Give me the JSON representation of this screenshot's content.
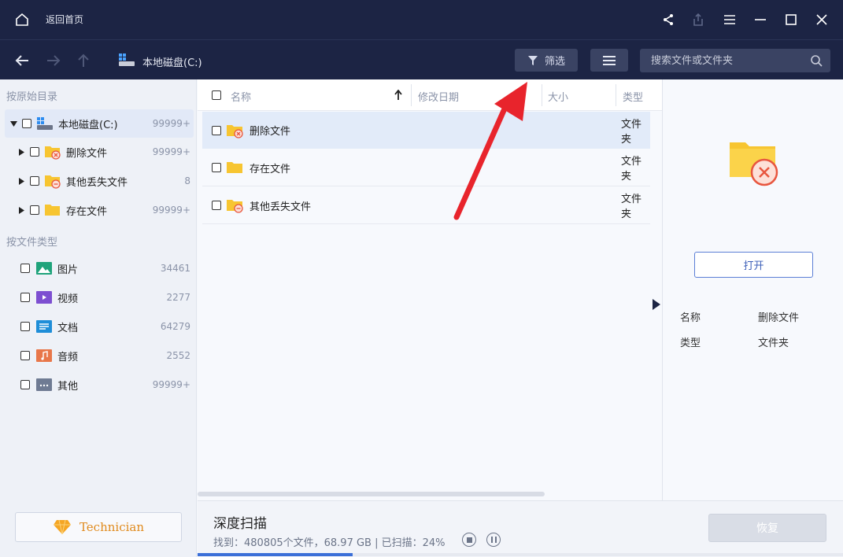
{
  "titlebar": {
    "home_label": "返回首页",
    "icons": [
      "home-icon",
      "share-icon",
      "export-icon",
      "menu-icon",
      "minimize-icon",
      "maximize-icon",
      "close-icon"
    ]
  },
  "toolbar": {
    "path": "本地磁盘(C:)",
    "filter_label": "筛选",
    "search_placeholder": "搜索文件或文件夹"
  },
  "sidebar": {
    "section_original": "按原始目录",
    "tree": [
      {
        "label": "本地磁盘(C:)",
        "count": "99999+"
      },
      {
        "label": "删除文件",
        "count": "99999+"
      },
      {
        "label": "其他丢失文件",
        "count": "8"
      },
      {
        "label": "存在文件",
        "count": "99999+"
      }
    ],
    "section_type": "按文件类型",
    "types": [
      {
        "label": "图片",
        "count": "34461",
        "icon": "image-icon",
        "color": "#1fa37b"
      },
      {
        "label": "视频",
        "count": "2277",
        "icon": "video-icon",
        "color": "#7d4fd1"
      },
      {
        "label": "文档",
        "count": "64279",
        "icon": "document-icon",
        "color": "#1f8ed8"
      },
      {
        "label": "音频",
        "count": "2552",
        "icon": "audio-icon",
        "color": "#e8774a"
      },
      {
        "label": "其他",
        "count": "99999+",
        "icon": "other-icon",
        "color": "#6f7b93"
      }
    ],
    "technician_label": "Technician"
  },
  "filelist": {
    "headers": {
      "name": "名称",
      "modified": "修改日期",
      "size": "大小",
      "type": "类型"
    },
    "rows": [
      {
        "name": "删除文件",
        "type": "文件夹"
      },
      {
        "name": "存在文件",
        "type": "文件夹"
      },
      {
        "name": "其他丢失文件",
        "type": "文件夹"
      }
    ]
  },
  "preview": {
    "open_label": "打开",
    "info": [
      {
        "key": "名称",
        "value": "删除文件"
      },
      {
        "key": "类型",
        "value": "文件夹"
      }
    ]
  },
  "status": {
    "title": "深度扫描",
    "info": "找到：480805个文件，68.97 GB | 已扫描：24%",
    "progress": 0.24,
    "recover_label": "恢复"
  },
  "colors": {
    "dark_bar": "#1c2444",
    "accent": "#3b6fd8",
    "folder": "#f7c531",
    "deleted_badge": "#e8563f",
    "annotation_arrow": "#e8242c"
  }
}
